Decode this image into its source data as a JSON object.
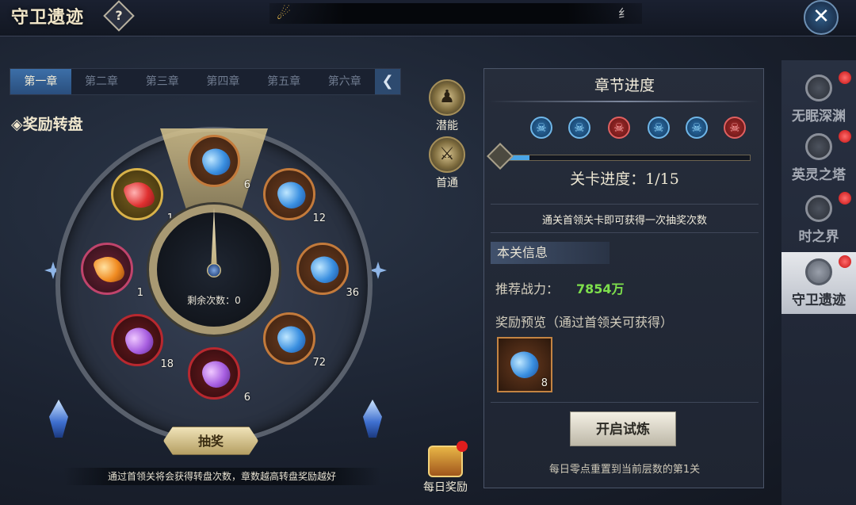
{
  "header": {
    "title": "守卫遗迹",
    "help_label": "?",
    "marquee_text": "纟",
    "close_label": "✕"
  },
  "chapters": {
    "tabs": [
      "第一章",
      "第二章",
      "第三章",
      "第四章",
      "第五章",
      "第六章"
    ],
    "active_index": 0,
    "more_arrow": "❮"
  },
  "wheel": {
    "section_title": "◈奖励转盘",
    "remaining_label": "剩余次数：0",
    "slots": [
      {
        "item": "blue-gem",
        "count": "6"
      },
      {
        "item": "blue-gem",
        "count": "12"
      },
      {
        "item": "blue-gem",
        "count": "36"
      },
      {
        "item": "blue-gem",
        "count": "72"
      },
      {
        "item": "purple-gem",
        "count": "6"
      },
      {
        "item": "purple-gem",
        "count": "18"
      },
      {
        "item": "orange-armor",
        "count": "1"
      },
      {
        "item": "red-armor",
        "count": "1"
      }
    ],
    "draw_button": "抽奖",
    "note": "通过首领关将会获得转盘次数，章数越高转盘奖励越好"
  },
  "middle": {
    "potential_label": "潜能",
    "first_clear_label": "首通",
    "daily_reward_label": "每日奖励"
  },
  "panel": {
    "title": "章节进度",
    "skulls": [
      "blue",
      "blue",
      "red",
      "blue",
      "blue",
      "red"
    ],
    "progress_fraction": 0.125,
    "stage_progress": "关卡进度：1/15",
    "hint": "通关首领关卡即可获得一次抽奖次数",
    "info_tab": "本关信息",
    "power_label": "推荐战力：",
    "power_value": "7854万",
    "preview_label": "奖励预览（通过首领关可获得）",
    "reward_count": "8",
    "start_button": "开启试炼",
    "reset_note": "每日零点重置到当前层数的第1关"
  },
  "sidebar": {
    "items": [
      {
        "label": "无眠深渊",
        "badge": true
      },
      {
        "label": "英灵之塔",
        "badge": true
      },
      {
        "label": "时之界",
        "badge": true
      },
      {
        "label": "守卫遗迹",
        "badge": true,
        "active": true
      }
    ]
  }
}
